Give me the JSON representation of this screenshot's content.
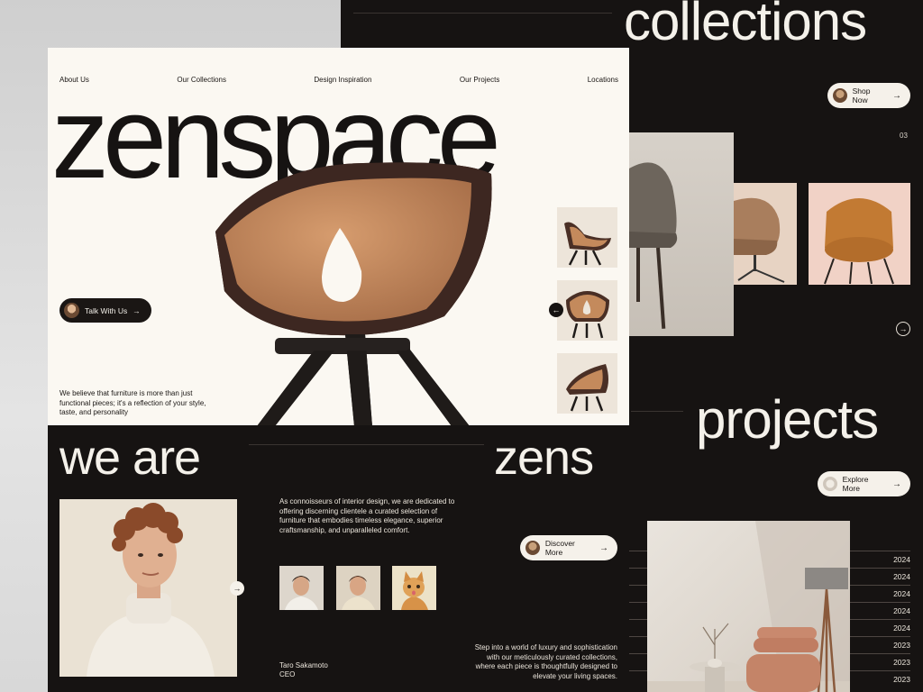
{
  "nav": {
    "items": [
      "About Us",
      "Our Collections",
      "Design Inspiration",
      "Our Projects",
      "Locations"
    ]
  },
  "hero": {
    "brand": "zenspace",
    "talk_label": "Talk With Us",
    "tagline": "We believe that furniture is more than just functional pieces; it's a reflection of your style, taste, and personality"
  },
  "about": {
    "title_left": "we are",
    "title_right": "zens",
    "description": "As connoisseurs of interior design, we are dedicated to offering discerning clientele a curated selection of furniture that embodies timeless elegance, superior craftsmanship, and unparalleled comfort.",
    "discover_label": "Discover More",
    "person_name": "Taro Sakamoto",
    "person_role": "CEO",
    "luxury_text": "Step into a world of luxury and sophistication with our meticulously curated collections, where each piece is thoughtfully designed to elevate your living spaces."
  },
  "collections": {
    "title": "collections",
    "shop_label": "Shop Now",
    "counter": "03"
  },
  "projects": {
    "title": "projects",
    "explore_label": "Explore More",
    "years": [
      "2024",
      "2024",
      "2024",
      "2024",
      "2024",
      "2023",
      "2023",
      "2023"
    ]
  },
  "icons": {
    "arrow_right": "→",
    "arrow_left": "←"
  },
  "colors": {
    "dark": "#161312",
    "cream": "#fbf8f2",
    "leather": "#c48a5c",
    "shell": "#4a2f25"
  }
}
